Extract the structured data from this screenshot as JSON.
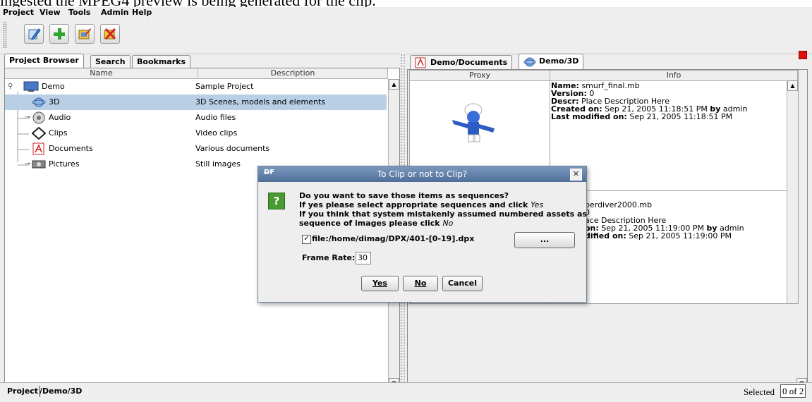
{
  "caption": "ingested the MPEG4 preview is being generated for the clip.",
  "menu": [
    "Project",
    "View",
    "Tools",
    "Admin",
    "Help"
  ],
  "toolbar": {
    "icons": [
      "edit-icon",
      "add-icon",
      "edit-document-icon",
      "delete-icon"
    ]
  },
  "left_tabs": [
    "Project Browser",
    "Search",
    "Bookmarks"
  ],
  "tree": {
    "columns": [
      "Name",
      "Description"
    ],
    "rows": [
      {
        "name": "Demo",
        "desc": "Sample Project",
        "icon": "monitor-icon"
      },
      {
        "name": "3D",
        "desc": "3D Scenes, models and elements",
        "icon": "3d-icon",
        "selected": true
      },
      {
        "name": "Audio",
        "desc": "Audio files",
        "icon": "speaker-icon"
      },
      {
        "name": "Clips",
        "desc": "Video clips",
        "icon": "clip-icon"
      },
      {
        "name": "Documents",
        "desc": "Various documents",
        "icon": "pdf-icon"
      },
      {
        "name": "Pictures",
        "desc": "Still images",
        "icon": "camera-icon"
      }
    ]
  },
  "right_tabs": [
    "Demo/Documents",
    "Demo/3D"
  ],
  "grid": {
    "columns": [
      "Proxy",
      "Info"
    ],
    "item1": {
      "name_label": "Name:",
      "name": " smurf_final.mb",
      "version_label": "Version:",
      "version": " 0",
      "descr_label": "Descr:",
      "descr": " Place Description Here",
      "created_label": "Created on:",
      "created": " Sep 21, 2005 11:18:51 PM ",
      "by_label": "by",
      "created_by": " admin",
      "modified_label": "Last modified on:",
      "modified": " Sep 21, 2005 11:18:51 PM"
    },
    "item2": {
      "name_partial": "perdiver2000.mb",
      "version_partial": "0",
      "descr_partial": "ace Description Here",
      "created_label_partial": "on:",
      "created": " Sep 21, 2005 11:19:00 PM ",
      "by_label": "by",
      "created_by": " admin",
      "modified_label_partial": "dified on:",
      "modified": " Sep 21, 2005 11:19:00 PM"
    }
  },
  "status": {
    "left_label": "Project",
    "path": "/Demo/3D",
    "selected_label": "Selected",
    "selected_value": "0 of 2"
  },
  "dialog": {
    "title": "To Clip or not to Clip?",
    "lines": [
      "Do you want to save those items as sequences?",
      "If yes please select appropriate sequences and click ",
      "If you think that system mistakenly assumed numbered assets as",
      "sequence of images please click "
    ],
    "yes_word": "Yes",
    "no_word": "No",
    "checkbox_label": "file:/home/dimag/DPX/401-[0-19].dpx",
    "browse_label": "...",
    "frame_rate_label": "Frame Rate:",
    "frame_rate_value": "30",
    "buttons": {
      "yes": "Yes",
      "no": "No",
      "cancel": "Cancel"
    }
  }
}
